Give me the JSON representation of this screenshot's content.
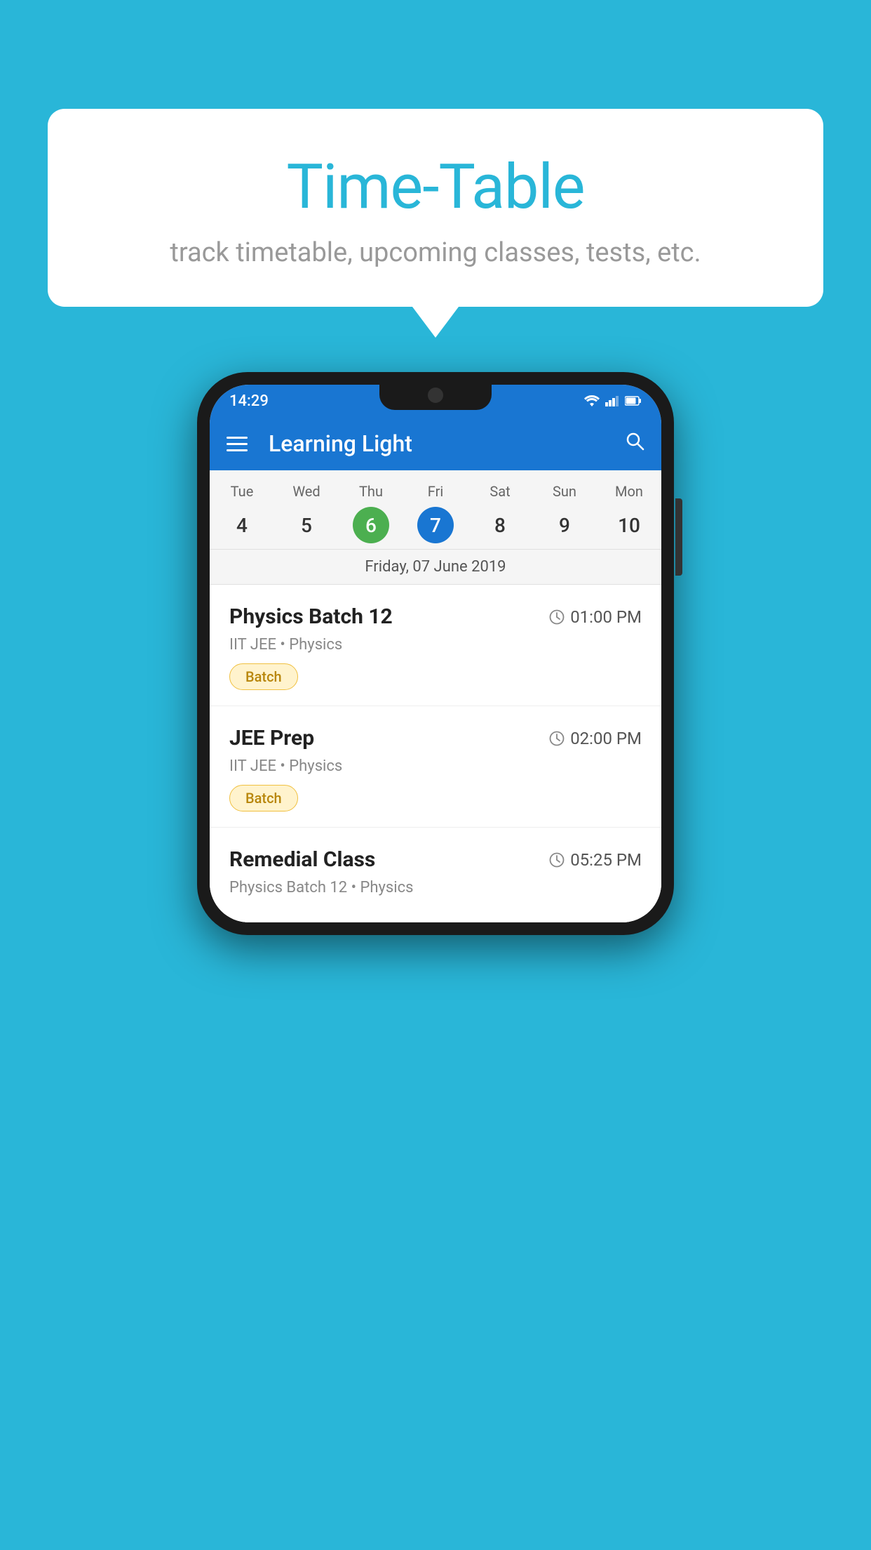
{
  "background": {
    "color": "#29b6d8"
  },
  "bubble": {
    "title": "Time-Table",
    "subtitle": "track timetable, upcoming classes, tests, etc."
  },
  "phone": {
    "status_bar": {
      "time": "14:29",
      "icons": [
        "wifi",
        "signal",
        "battery"
      ]
    },
    "app_bar": {
      "title": "Learning Light",
      "menu_icon": "hamburger",
      "search_icon": "search"
    },
    "calendar": {
      "days": [
        {
          "name": "Tue",
          "num": "4",
          "state": "normal"
        },
        {
          "name": "Wed",
          "num": "5",
          "state": "normal"
        },
        {
          "name": "Thu",
          "num": "6",
          "state": "today"
        },
        {
          "name": "Fri",
          "num": "7",
          "state": "selected"
        },
        {
          "name": "Sat",
          "num": "8",
          "state": "normal"
        },
        {
          "name": "Sun",
          "num": "9",
          "state": "normal"
        },
        {
          "name": "Mon",
          "num": "10",
          "state": "normal"
        }
      ],
      "selected_date_label": "Friday, 07 June 2019"
    },
    "schedule": [
      {
        "title": "Physics Batch 12",
        "time": "01:00 PM",
        "subtitle": "IIT JEE • Physics",
        "badge": "Batch"
      },
      {
        "title": "JEE Prep",
        "time": "02:00 PM",
        "subtitle": "IIT JEE • Physics",
        "badge": "Batch"
      },
      {
        "title": "Remedial Class",
        "time": "05:25 PM",
        "subtitle": "Physics Batch 12 • Physics",
        "badge": ""
      }
    ]
  }
}
